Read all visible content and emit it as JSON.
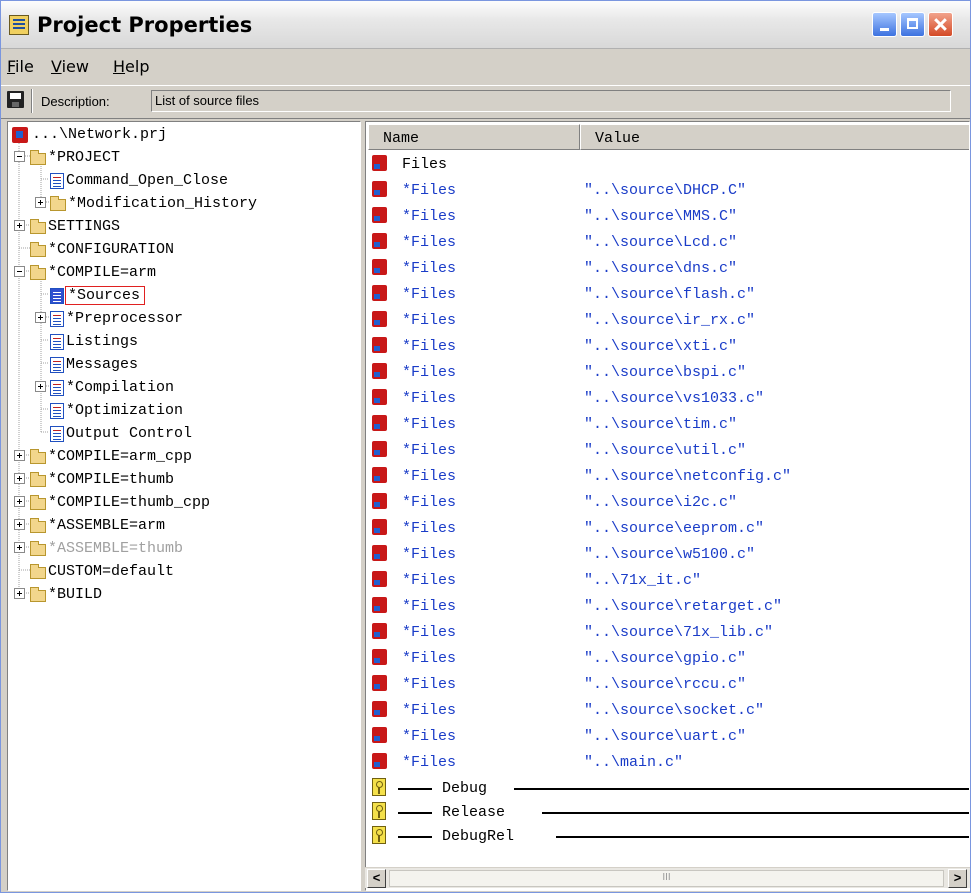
{
  "window": {
    "title": "Project Properties"
  },
  "menu": {
    "file": "File",
    "view": "View",
    "help": "Help"
  },
  "toolbar": {
    "description_label": "Description:",
    "description_value": "List of source files"
  },
  "tree": {
    "root": "...\\Network.prj",
    "nodes": [
      {
        "label": "*PROJECT",
        "icon": "folder"
      },
      {
        "label": "Command_Open_Close",
        "icon": "page"
      },
      {
        "label": "*Modification_History",
        "icon": "folder"
      },
      {
        "label": "SETTINGS",
        "icon": "folder"
      },
      {
        "label": "*CONFIGURATION",
        "icon": "folder"
      },
      {
        "label": "*COMPILE=arm",
        "icon": "folder"
      },
      {
        "label": "*Sources",
        "icon": "page-active",
        "selected": true
      },
      {
        "label": "*Preprocessor",
        "icon": "page"
      },
      {
        "label": "Listings",
        "icon": "page"
      },
      {
        "label": "Messages",
        "icon": "page"
      },
      {
        "label": "*Compilation",
        "icon": "page"
      },
      {
        "label": "*Optimization",
        "icon": "page"
      },
      {
        "label": "Output Control",
        "icon": "page"
      },
      {
        "label": "*COMPILE=arm_cpp",
        "icon": "folder"
      },
      {
        "label": "*COMPILE=thumb",
        "icon": "folder"
      },
      {
        "label": "*COMPILE=thumb_cpp",
        "icon": "folder"
      },
      {
        "label": "*ASSEMBLE=arm",
        "icon": "folder"
      },
      {
        "label": "*ASSEMBLE=thumb",
        "icon": "folder",
        "dim": true
      },
      {
        "label": "CUSTOM=default",
        "icon": "folder"
      },
      {
        "label": "*BUILD",
        "icon": "folder"
      }
    ]
  },
  "list": {
    "col_name": "Name",
    "col_value": "Value",
    "header_row": "Files",
    "rows": [
      {
        "name": "*Files",
        "value": "\"..\\source\\DHCP.C\""
      },
      {
        "name": "*Files",
        "value": "\"..\\source\\MMS.C\""
      },
      {
        "name": "*Files",
        "value": "\"..\\source\\Lcd.c\""
      },
      {
        "name": "*Files",
        "value": "\"..\\source\\dns.c\""
      },
      {
        "name": "*Files",
        "value": "\"..\\source\\flash.c\""
      },
      {
        "name": "*Files",
        "value": "\"..\\source\\ir_rx.c\""
      },
      {
        "name": "*Files",
        "value": "\"..\\source\\xti.c\""
      },
      {
        "name": "*Files",
        "value": "\"..\\source\\bspi.c\""
      },
      {
        "name": "*Files",
        "value": "\"..\\source\\vs1033.c\""
      },
      {
        "name": "*Files",
        "value": "\"..\\source\\tim.c\""
      },
      {
        "name": "*Files",
        "value": "\"..\\source\\util.c\""
      },
      {
        "name": "*Files",
        "value": "\"..\\source\\netconfig.c\""
      },
      {
        "name": "*Files",
        "value": "\"..\\source\\i2c.c\""
      },
      {
        "name": "*Files",
        "value": "\"..\\source\\eeprom.c\""
      },
      {
        "name": "*Files",
        "value": "\"..\\source\\w5100.c\""
      },
      {
        "name": "*Files",
        "value": "\"..\\71x_it.c\""
      },
      {
        "name": "*Files",
        "value": "\"..\\source\\retarget.c\""
      },
      {
        "name": "*Files",
        "value": "\"..\\source\\71x_lib.c\""
      },
      {
        "name": "*Files",
        "value": "\"..\\source\\gpio.c\""
      },
      {
        "name": "*Files",
        "value": "\"..\\source\\rccu.c\""
      },
      {
        "name": "*Files",
        "value": "\"..\\source\\socket.c\""
      },
      {
        "name": "*Files",
        "value": "\"..\\source\\uart.c\""
      },
      {
        "name": "*Files",
        "value": "\"..\\main.c\""
      }
    ],
    "configs": [
      "Debug",
      "Release",
      "DebugRel"
    ]
  },
  "scrollbar": {
    "left": "<",
    "right": ">",
    "grip": "III"
  }
}
